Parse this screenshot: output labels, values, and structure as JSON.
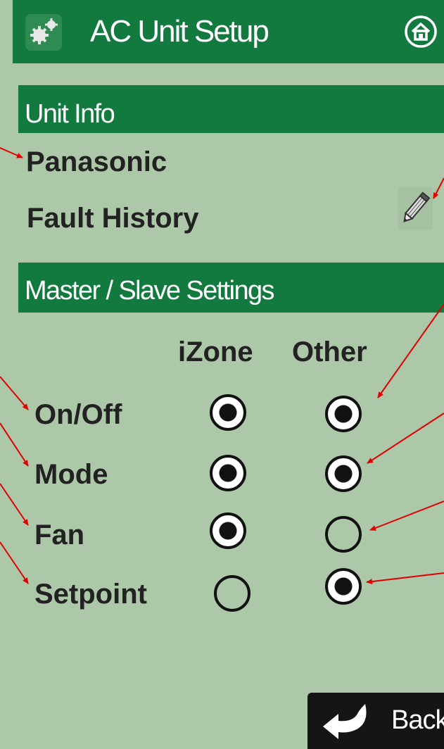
{
  "header": {
    "title": "AC Unit Setup",
    "icons": [
      "gears-icon",
      "home-icon"
    ],
    "color": "#127a3f"
  },
  "unit_info": {
    "section_title": "Unit Info",
    "brand": "Panasonic",
    "fault_history": "Fault History",
    "edit_icon": "pencil-icon"
  },
  "master_slave": {
    "section_title": "Master / Slave Settings",
    "columns": [
      "iZone",
      "Other"
    ],
    "rows": [
      {
        "label": "On/Off",
        "izone_selected": true,
        "other_selected": true
      },
      {
        "label": "Mode",
        "izone_selected": true,
        "other_selected": true
      },
      {
        "label": "Fan",
        "izone_selected": true,
        "other_selected": false
      },
      {
        "label": "Setpoint",
        "izone_selected": false,
        "other_selected": true
      }
    ]
  },
  "footer": {
    "back_label": "Back",
    "back_icon": "return-arrow-icon"
  },
  "colors": {
    "background": "#adc7a9",
    "annotation_arrow": "#e00000"
  }
}
